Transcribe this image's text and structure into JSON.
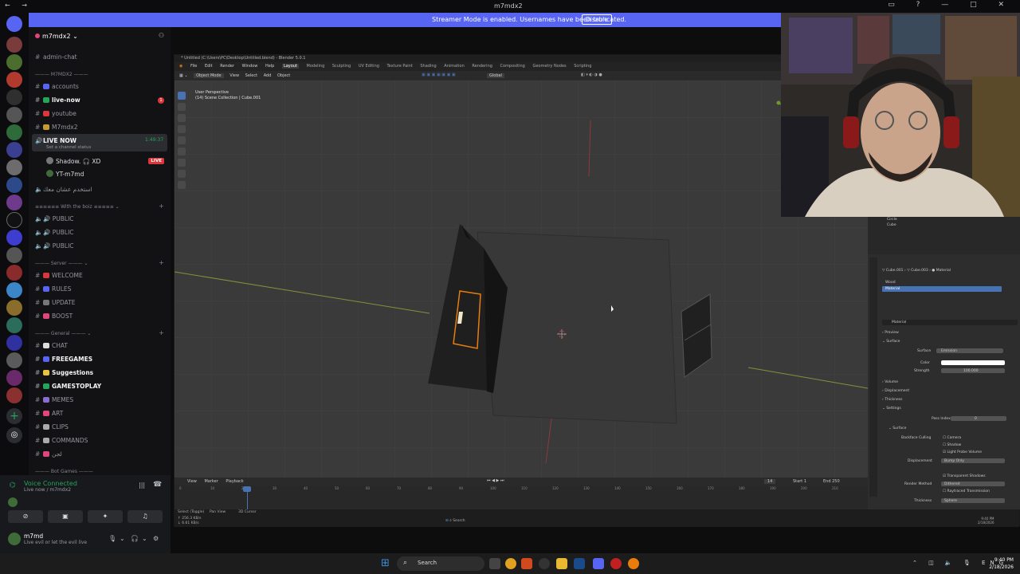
{
  "window": {
    "title": "m7mdx2"
  },
  "banner": {
    "message": "Streamer Mode is enabled. Usernames have been truncated.",
    "disable_label": "Disable"
  },
  "guild": {
    "name": "m7mdx2",
    "channels": {
      "admin_chat": "admin-chat",
      "cat_m7mdx2": "M7MDX2",
      "accounts": "accounts",
      "live_now": "live-now",
      "live_now_badge": "1",
      "youtube": "youtube",
      "m7mdx2": "M7mdx2",
      "voice_live_now": "LIVE NOW",
      "voice_timer": "1:49:37",
      "set_status": "Set a channel status",
      "member1": "Shadow.",
      "member1_tag": "XD",
      "member1_live": "LIVE",
      "member2": "YT-m7md",
      "arabic_voice": "استخدم عشان معك",
      "cat_boiz": "With the boiz",
      "public1": "PUBLIC",
      "public2": "PUBLIC",
      "public3": "PUBLIC",
      "cat_server": "Server",
      "welcome": "WELCOME",
      "rules": "RULES",
      "update": "UPDATE",
      "boost": "BOOST",
      "cat_general": "General",
      "chat": "CHAT",
      "freegames": "FREEGAMES",
      "suggestions": "Suggestions",
      "gamestoplay": "GAMESTOPLAY",
      "memes": "MEMES",
      "art": "ART",
      "clips": "CLIPS",
      "commands": "COMMANDS",
      "arabic2": "لجن",
      "cat_bot": "Bot Games"
    }
  },
  "voice_panel": {
    "connected": "Voice Connected",
    "location": "Live now / m7mdx2",
    "username": "m7md",
    "status": "Live evil or let the evil live"
  },
  "blender": {
    "title": "* Untitled (C:\\Users\\PC\\Desktop\\Untitled.blend) - Blender 5.0.1",
    "menus": [
      "File",
      "Edit",
      "Render",
      "Window",
      "Help"
    ],
    "workspaces": [
      "Layout",
      "Modeling",
      "Sculpting",
      "UV Editing",
      "Texture Paint",
      "Shading",
      "Animation",
      "Rendering",
      "Compositing",
      "Geometry Nodes",
      "Scripting"
    ],
    "active_workspace": "Layout",
    "mode": "Object Mode",
    "header_menus": [
      "View",
      "Select",
      "Add",
      "Object"
    ],
    "transform": "Global",
    "viewport_info_1": "User Perspective",
    "viewport_info_2": "(14) Scene Collection | Cube.001",
    "outliner_items": [
      "Circle",
      "Cube"
    ],
    "props": {
      "object": "Cube.001",
      "mesh": "Cube.003",
      "material_tab": "Material",
      "slot1": "Wood",
      "slot2": "Material",
      "material_name": "Material",
      "preview": "Preview",
      "surface": "Surface",
      "surface_label": "Surface",
      "surface_value": "Emission",
      "color_label": "Color",
      "strength_label": "Strength",
      "strength_value": "100.000",
      "volume": "Volume",
      "displacement": "Displacement",
      "thickness": "Thickness",
      "settings": "Settings",
      "pass_index_label": "Pass Index",
      "pass_index_value": "0",
      "surface2": "Surface",
      "backface": "Backface Culling",
      "camera": "Camera",
      "shadow": "Shadow",
      "light_probe": "Light Probe Volume",
      "displacement_label": "Displacement",
      "displacement_value": "Bump Only",
      "transparent_shadows": "Transparent Shadows",
      "render_method_label": "Render Method",
      "render_method_value": "Dithered",
      "raytraced": "Raytraced Transmission",
      "thickness_label": "Thickness",
      "thickness_value": "Sphere"
    },
    "timeline": {
      "menus": [
        "View",
        "Marker",
        "Playback"
      ],
      "current_frame": "14",
      "start_label": "Start",
      "start": "1",
      "end_label": "End",
      "end": "250",
      "ticks": [
        "0",
        "10",
        "20",
        "30",
        "40",
        "50",
        "60",
        "70",
        "80",
        "90",
        "100",
        "110",
        "120",
        "130",
        "140",
        "150",
        "160",
        "170",
        "180",
        "190",
        "200",
        "210",
        "220",
        "230",
        "240",
        "250"
      ]
    },
    "status_left": "Select (Toggle)",
    "status_mid": "Pan View",
    "status_right": "3D Cursor",
    "speed_up": "↑ 256.3 KB/s",
    "speed_down": "↓ 6.61 KB/s",
    "inner_time": "9:40 PM",
    "inner_date": "2/18/2026"
  },
  "taskbar": {
    "search": "Search",
    "lang": "ENG",
    "time": "9:40 PM",
    "date": "2/18/2026"
  },
  "colors": {
    "accent": "#5865f2",
    "voice_green": "#23a55a",
    "live_red": "#da373c",
    "blender_select": "#4772b3",
    "object_orange": "#e87d0d"
  }
}
